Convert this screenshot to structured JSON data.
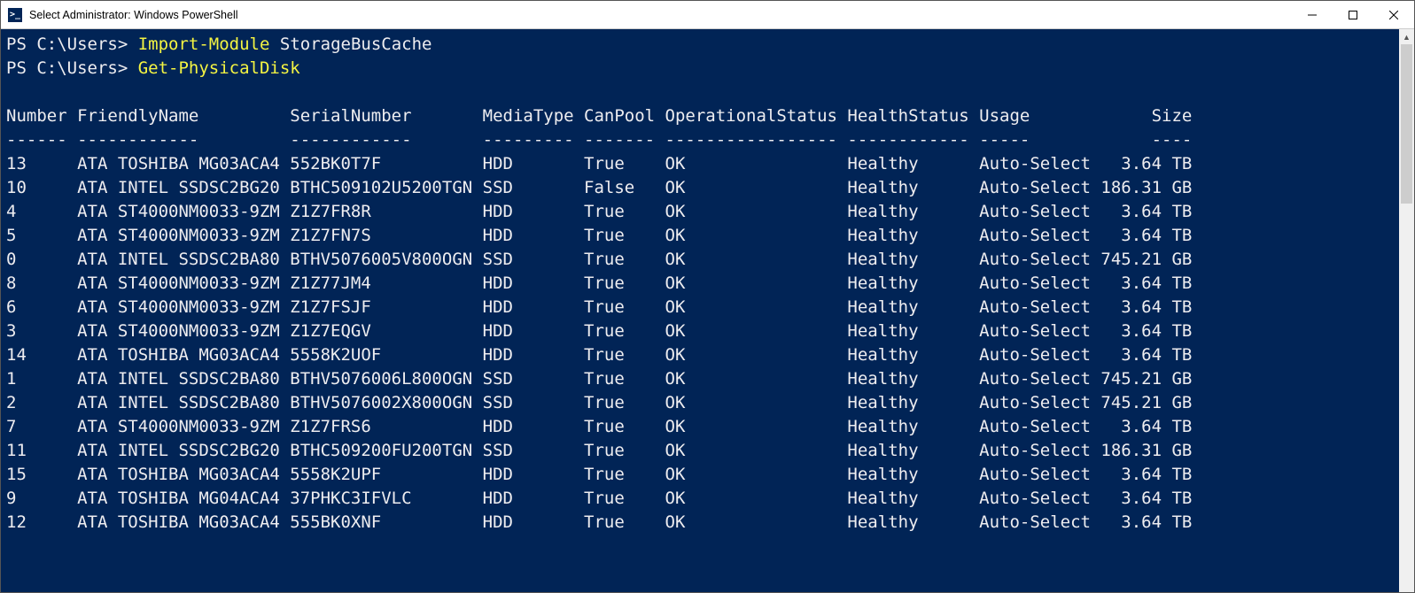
{
  "window": {
    "icon_text": ">_",
    "title": "Select Administrator: Windows PowerShell"
  },
  "prompt1": "PS C:\\Users> ",
  "cmd1_a": "Import-Module",
  "cmd1_b": " StorageBusCache",
  "prompt2": "PS C:\\Users> ",
  "cmd2": "Get-PhysicalDisk",
  "headers": {
    "number": "Number",
    "friendlyName": "FriendlyName",
    "serialNumber": "SerialNumber",
    "mediaType": "MediaType",
    "canPool": "CanPool",
    "operationalStatus": "OperationalStatus",
    "healthStatus": "HealthStatus",
    "usage": "Usage",
    "size": "Size"
  },
  "dashes": {
    "number": "------",
    "friendlyName": "------------",
    "serialNumber": "------------",
    "mediaType": "---------",
    "canPool": "-------",
    "operationalStatus": "-----------------",
    "healthStatus": "------------",
    "usage": "-----",
    "size": "----"
  },
  "rows": [
    {
      "number": "13",
      "friendlyName": "ATA TOSHIBA MG03ACA4",
      "serialNumber": "552BK0T7F",
      "mediaType": "HDD",
      "canPool": "True",
      "operationalStatus": "OK",
      "healthStatus": "Healthy",
      "usage": "Auto-Select",
      "size": "3.64 TB"
    },
    {
      "number": "10",
      "friendlyName": "ATA INTEL SSDSC2BG20",
      "serialNumber": "BTHC509102U5200TGN",
      "mediaType": "SSD",
      "canPool": "False",
      "operationalStatus": "OK",
      "healthStatus": "Healthy",
      "usage": "Auto-Select",
      "size": "186.31 GB"
    },
    {
      "number": "4",
      "friendlyName": "ATA ST4000NM0033-9ZM",
      "serialNumber": "Z1Z7FR8R",
      "mediaType": "HDD",
      "canPool": "True",
      "operationalStatus": "OK",
      "healthStatus": "Healthy",
      "usage": "Auto-Select",
      "size": "3.64 TB"
    },
    {
      "number": "5",
      "friendlyName": "ATA ST4000NM0033-9ZM",
      "serialNumber": "Z1Z7FN7S",
      "mediaType": "HDD",
      "canPool": "True",
      "operationalStatus": "OK",
      "healthStatus": "Healthy",
      "usage": "Auto-Select",
      "size": "3.64 TB"
    },
    {
      "number": "0",
      "friendlyName": "ATA INTEL SSDSC2BA80",
      "serialNumber": "BTHV5076005V800OGN",
      "mediaType": "SSD",
      "canPool": "True",
      "operationalStatus": "OK",
      "healthStatus": "Healthy",
      "usage": "Auto-Select",
      "size": "745.21 GB"
    },
    {
      "number": "8",
      "friendlyName": "ATA ST4000NM0033-9ZM",
      "serialNumber": "Z1Z77JM4",
      "mediaType": "HDD",
      "canPool": "True",
      "operationalStatus": "OK",
      "healthStatus": "Healthy",
      "usage": "Auto-Select",
      "size": "3.64 TB"
    },
    {
      "number": "6",
      "friendlyName": "ATA ST4000NM0033-9ZM",
      "serialNumber": "Z1Z7FSJF",
      "mediaType": "HDD",
      "canPool": "True",
      "operationalStatus": "OK",
      "healthStatus": "Healthy",
      "usage": "Auto-Select",
      "size": "3.64 TB"
    },
    {
      "number": "3",
      "friendlyName": "ATA ST4000NM0033-9ZM",
      "serialNumber": "Z1Z7EQGV",
      "mediaType": "HDD",
      "canPool": "True",
      "operationalStatus": "OK",
      "healthStatus": "Healthy",
      "usage": "Auto-Select",
      "size": "3.64 TB"
    },
    {
      "number": "14",
      "friendlyName": "ATA TOSHIBA MG03ACA4",
      "serialNumber": "5558K2UOF",
      "mediaType": "HDD",
      "canPool": "True",
      "operationalStatus": "OK",
      "healthStatus": "Healthy",
      "usage": "Auto-Select",
      "size": "3.64 TB"
    },
    {
      "number": "1",
      "friendlyName": "ATA INTEL SSDSC2BA80",
      "serialNumber": "BTHV5076006L800OGN",
      "mediaType": "SSD",
      "canPool": "True",
      "operationalStatus": "OK",
      "healthStatus": "Healthy",
      "usage": "Auto-Select",
      "size": "745.21 GB"
    },
    {
      "number": "2",
      "friendlyName": "ATA INTEL SSDSC2BA80",
      "serialNumber": "BTHV5076002X800OGN",
      "mediaType": "SSD",
      "canPool": "True",
      "operationalStatus": "OK",
      "healthStatus": "Healthy",
      "usage": "Auto-Select",
      "size": "745.21 GB"
    },
    {
      "number": "7",
      "friendlyName": "ATA ST4000NM0033-9ZM",
      "serialNumber": "Z1Z7FRS6",
      "mediaType": "HDD",
      "canPool": "True",
      "operationalStatus": "OK",
      "healthStatus": "Healthy",
      "usage": "Auto-Select",
      "size": "3.64 TB"
    },
    {
      "number": "11",
      "friendlyName": "ATA INTEL SSDSC2BG20",
      "serialNumber": "BTHC509200FU200TGN",
      "mediaType": "SSD",
      "canPool": "True",
      "operationalStatus": "OK",
      "healthStatus": "Healthy",
      "usage": "Auto-Select",
      "size": "186.31 GB"
    },
    {
      "number": "15",
      "friendlyName": "ATA TOSHIBA MG03ACA4",
      "serialNumber": "5558K2UPF",
      "mediaType": "HDD",
      "canPool": "True",
      "operationalStatus": "OK",
      "healthStatus": "Healthy",
      "usage": "Auto-Select",
      "size": "3.64 TB"
    },
    {
      "number": "9",
      "friendlyName": "ATA TOSHIBA MG04ACA4",
      "serialNumber": "37PHKC3IFVLC",
      "mediaType": "HDD",
      "canPool": "True",
      "operationalStatus": "OK",
      "healthStatus": "Healthy",
      "usage": "Auto-Select",
      "size": "3.64 TB"
    },
    {
      "number": "12",
      "friendlyName": "ATA TOSHIBA MG03ACA4",
      "serialNumber": "555BK0XNF",
      "mediaType": "HDD",
      "canPool": "True",
      "operationalStatus": "OK",
      "healthStatus": "Healthy",
      "usage": "Auto-Select",
      "size": "3.64 TB"
    }
  ],
  "cols": {
    "number": 7,
    "friendlyName": 21,
    "serialNumber": 19,
    "mediaType": 10,
    "canPool": 8,
    "operationalStatus": 18,
    "healthStatus": 13,
    "usage": 12,
    "size": 9
  }
}
